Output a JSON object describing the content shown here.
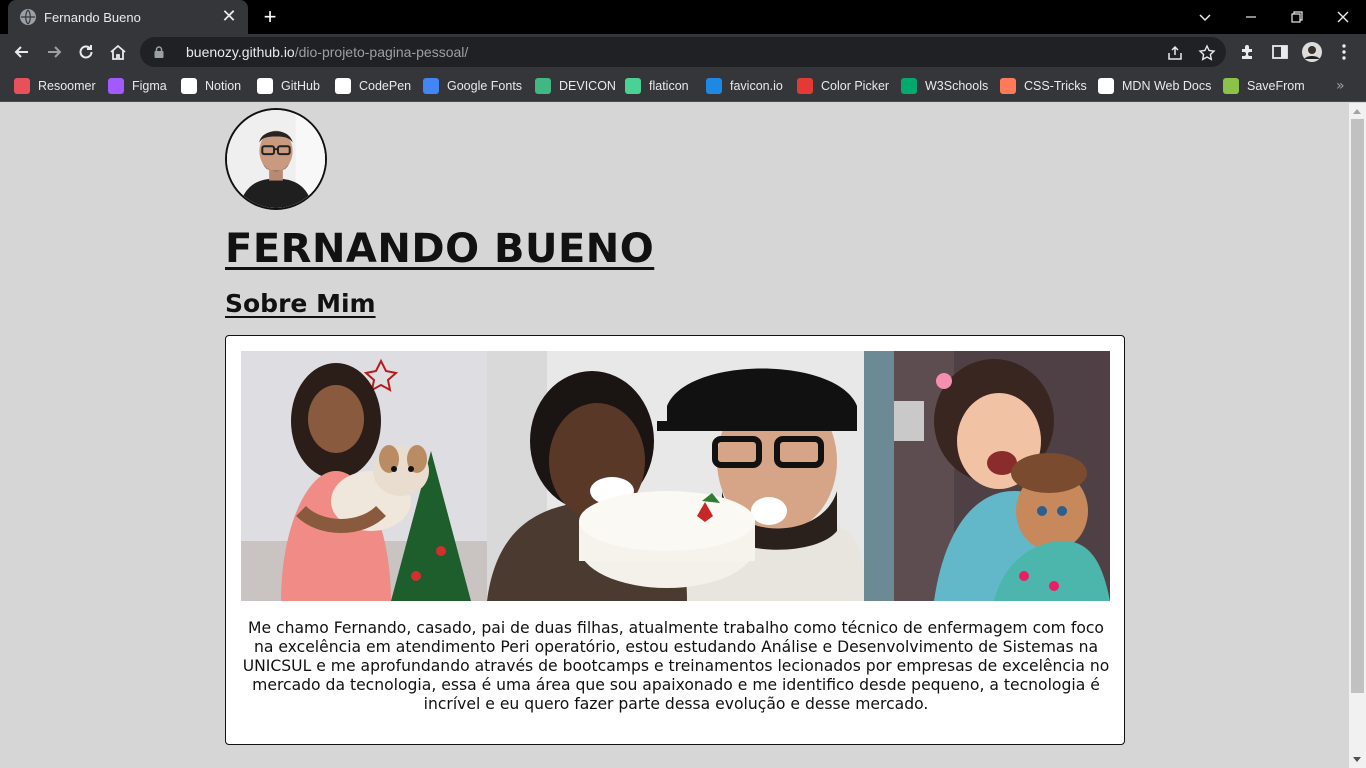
{
  "browser": {
    "tab_title": "Fernando Bueno",
    "url_host": "buenozy.github.io",
    "url_path": "/dio-projeto-pagina-pessoal/",
    "bookmarks": [
      {
        "label": "Resoomer",
        "icon": "resoomer-icon",
        "color": "#e8505b"
      },
      {
        "label": "Figma",
        "icon": "figma-icon",
        "color": "#a259ff"
      },
      {
        "label": "Notion",
        "icon": "notion-icon",
        "color": "#ffffff"
      },
      {
        "label": "GitHub",
        "icon": "github-icon",
        "color": "#ffffff"
      },
      {
        "label": "CodePen",
        "icon": "codepen-icon",
        "color": "#ffffff"
      },
      {
        "label": "Google Fonts",
        "icon": "google-fonts-icon",
        "color": "#4285f4"
      },
      {
        "label": "DEVICON",
        "icon": "devicon-icon",
        "color": "#41b883"
      },
      {
        "label": "flaticon",
        "icon": "flaticon-icon",
        "color": "#4ad295"
      },
      {
        "label": "favicon.io",
        "icon": "faviconio-icon",
        "color": "#1e88e5"
      },
      {
        "label": "Color Picker",
        "icon": "color-picker-icon",
        "color": "#e53935"
      },
      {
        "label": "W3Schools",
        "icon": "w3schools-icon",
        "color": "#04aa6d"
      },
      {
        "label": "CSS-Tricks",
        "icon": "css-tricks-icon",
        "color": "#ff7a59"
      },
      {
        "label": "MDN Web Docs",
        "icon": "mdn-icon",
        "color": "#ffffff"
      },
      {
        "label": "SaveFrom",
        "icon": "savefrom-icon",
        "color": "#8bc34a"
      }
    ]
  },
  "page": {
    "name": "FERNANDO BUENO",
    "subtitle": "Sobre Mim",
    "about": "Me chamo Fernando, casado, pai de duas filhas, atualmente trabalho como técnico de enfermagem com foco na excelência em atendimento Peri operatório, estou estudando Análise e Desenvolvimento de Sistemas na UNICSUL e me aprofundando através de bootcamps e treinamentos lecionados por empresas de excelência no mercado da tecnologia, essa é uma área que sou apaixonado e me identifico desde pequeno, a tecnologia é incrível e eu quero fazer parte dessa evolução e desse mercado.",
    "background_color": "#d6d6d6"
  }
}
